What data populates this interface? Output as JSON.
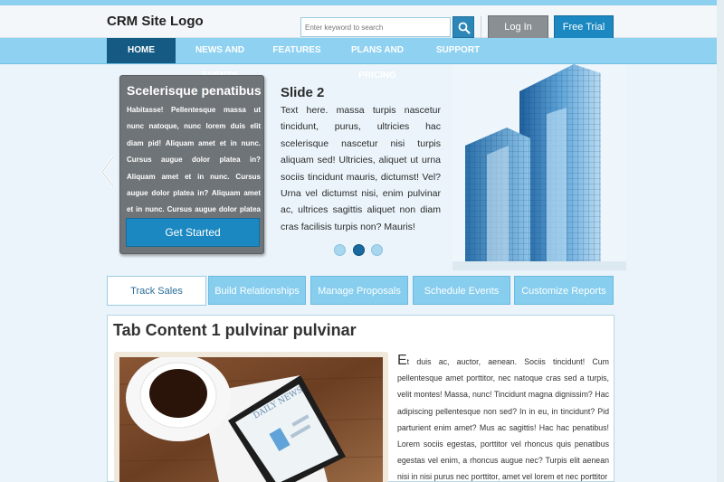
{
  "header": {
    "logo": "CRM Site Logo",
    "search_placeholder": "Enter keyword to search",
    "login_label": "Log In",
    "trial_label": "Free Trial"
  },
  "nav": {
    "items": [
      {
        "label": "HOME",
        "active": true
      },
      {
        "label": "NEWS AND EVENTS"
      },
      {
        "label": "FEATURES"
      },
      {
        "label": "PLANS AND PRICING"
      },
      {
        "label": "SUPPORT"
      }
    ]
  },
  "hero": {
    "cta_title": "Scelerisque penatibus",
    "cta_text": "Habitasse! Pellentesque massa ut nunc natoque, nunc lorem duis elit diam pid! Aliquam amet et in nunc. Cursus augue dolor platea in? Aliquam amet et in nunc. Cursus augue dolor platea in? Aliquam amet et in nunc. Cursus augue dolor platea in? Cursus augue dolor platea in?",
    "cta_button": "Get Started",
    "slide_title": "Slide 2",
    "slide_text": "Text here. massa turpis nascetur tincidunt, purus, ultricies hac scelerisque nascetur nisi turpis aliquam sed! Ultricies, aliquet ut urna sociis tincidunt mauris, dictumst! Vel? Urna vel dictumst nisi, enim pulvinar ac, ultrices sagittis aliquet non diam cras facilisis turpis non? Mauris!",
    "active_slide": 2,
    "slide_count": 3
  },
  "tabs": [
    {
      "label": "Track Sales",
      "active": true
    },
    {
      "label": "Build Relationships"
    },
    {
      "label": "Manage Proposals"
    },
    {
      "label": "Schedule Events"
    },
    {
      "label": "Customize Reports"
    }
  ],
  "content": {
    "title": "Tab Content 1 pulvinar pulvinar",
    "dropcap": "E",
    "text": "t duis ac, auctor, aenean. Sociis tincidunt! Cum pellentesque amet porttitor, nec natoque cras sed a turpis, velit montes! Massa, nunc! Tincidunt magna dignissim? Hac adipiscing pellentesque non sed? In in eu, in tincidunt? Pid parturient enim amet? Mus ac sagittis! Hac hac penatibus! Lorem sociis egestas, porttitor vel rhoncus quis penatibus egestas vel enim, a rhoncus augue nec? Turpis elit aenean nisi in nisi purus nec porttitor, amet vel lorem et nec porttitor",
    "photo_caption": "DAILY NEWS"
  },
  "colors": {
    "accent": "#1b88c1",
    "nav_bg": "#8fd1f1",
    "nav_active": "#155a82",
    "cta_box": "#6f7478"
  }
}
